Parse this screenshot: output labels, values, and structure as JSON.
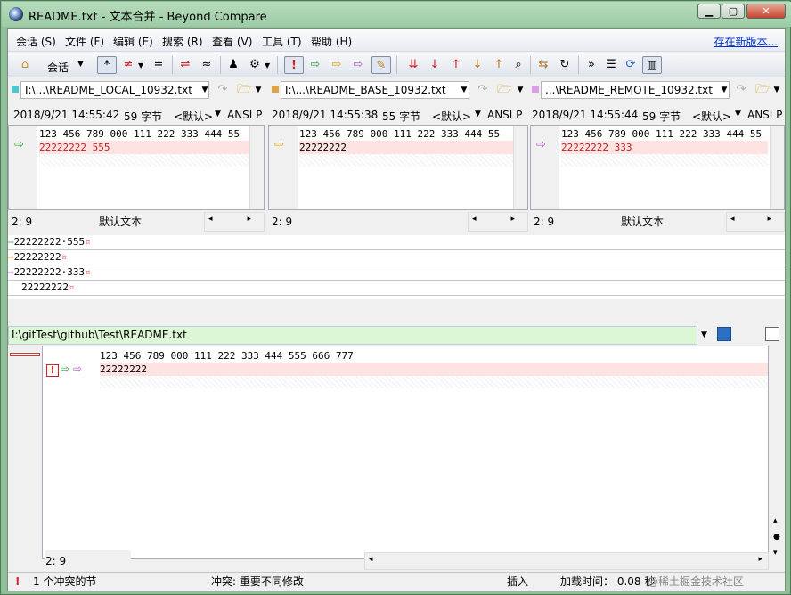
{
  "window": {
    "title": "README.txt - 文本合并 - Beyond Compare"
  },
  "menu": {
    "items": [
      "会话 (S)",
      "文件 (F)",
      "编辑 (E)",
      "搜索 (R)",
      "查看 (V)",
      "工具 (T)",
      "帮助 (H)"
    ],
    "update_link": "存在新版本..."
  },
  "toolbar": {
    "session_label": "会话"
  },
  "panes": [
    {
      "path": "I:\\...\\README_LOCAL_10932.txt",
      "color": "#4ec7cf",
      "timestamp": "2018/9/21 14:55:42",
      "size": "59 字节",
      "encoding": "<默认>",
      "charset": "ANSI P",
      "lines": [
        "123 456 789 000 111 222 333 444 55",
        "22222222 555"
      ],
      "status_pos": "2: 9",
      "status_text": "默认文本"
    },
    {
      "path": "I:\\...\\README_BASE_10932.txt",
      "color": "#d9a44a",
      "timestamp": "2018/9/21 14:55:38",
      "size": "55 字节",
      "encoding": "<默认>",
      "charset": "ANSI P",
      "lines": [
        "123 456 789 000 111 222 333 444 55",
        "22222222"
      ],
      "status_pos": "2: 9",
      "status_text": ""
    },
    {
      "path": "...\\README_REMOTE_10932.txt",
      "color": "#d9a0e8",
      "timestamp": "2018/9/21 14:55:44",
      "size": "59 字节",
      "encoding": "<默认>",
      "charset": "ANSI P",
      "lines": [
        "123 456 789 000 111 222 333 444 55",
        "22222222 333"
      ],
      "status_pos": "2: 9",
      "status_text": "默认文本"
    }
  ],
  "diff_lines": [
    "22222222·555",
    "22222222",
    "22222222·333",
    "22222222"
  ],
  "output": {
    "path": "I:\\gitTest\\github\\Test\\README.txt",
    "lines": [
      "123 456 789 000 111 222 333 444 555 666 777",
      "22222222"
    ],
    "status_pos": "2: 9"
  },
  "statusbar": {
    "conflicts": "1 个冲突的节",
    "conflict_type": "冲突: 重要不同修改",
    "mode": "插入",
    "load_time": "加载时间： 0.08 秒",
    "watermark": "@稀土掘金技术社区"
  },
  "colors": {
    "conflict_red": "#e02020",
    "diff_bg": "#ffe3e3",
    "output_path_bg": "#dbf7d6"
  }
}
